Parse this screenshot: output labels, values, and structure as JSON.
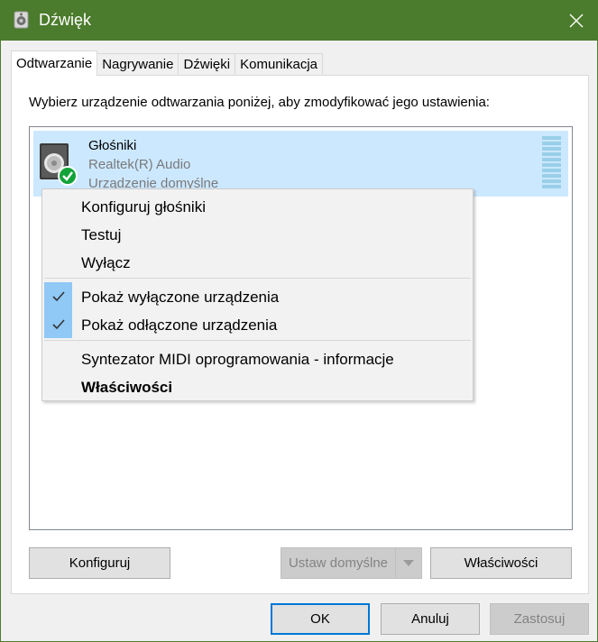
{
  "window": {
    "title": "Dźwięk"
  },
  "tabs": [
    {
      "label": "Odtwarzanie",
      "active": true
    },
    {
      "label": "Nagrywanie",
      "active": false
    },
    {
      "label": "Dźwięki",
      "active": false
    },
    {
      "label": "Komunikacja",
      "active": false
    }
  ],
  "panel": {
    "instruction": "Wybierz urządzenie odtwarzania poniżej, aby zmodyfikować jego ustawienia:"
  },
  "device": {
    "name": "Głośniki",
    "driver": "Realtek(R) Audio",
    "status": "Urządzenie domyślne",
    "icon": "speaker-icon",
    "badge_icon": "default-check-icon"
  },
  "context_menu": {
    "items": [
      {
        "label": "Konfiguruj głośniki"
      },
      {
        "label": "Testuj"
      },
      {
        "label": "Wyłącz"
      },
      {
        "label": "Pokaż wyłączone urządzenia",
        "checked": true
      },
      {
        "label": "Pokaż odłączone urządzenia",
        "checked": true
      },
      {
        "label": "Syntezator MIDI oprogramowania - informacje"
      },
      {
        "label": "Właściwości",
        "bold": true
      }
    ]
  },
  "panel_buttons": {
    "configure": "Konfiguruj",
    "set_default": "Ustaw domyślne",
    "properties": "Właściwości"
  },
  "dialog_buttons": {
    "ok": "OK",
    "cancel": "Anuluj",
    "apply": "Zastosuj"
  },
  "colors": {
    "titlebar": "#4b7b2c",
    "selection": "#cce8ff",
    "check_highlight": "#90c8f6",
    "default_badge": "#11a33a"
  }
}
